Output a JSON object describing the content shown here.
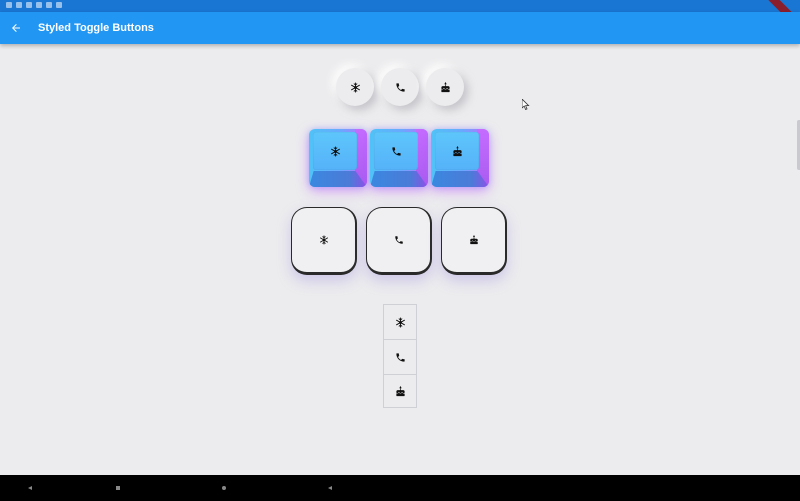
{
  "app_bar": {
    "title": "Styled Toggle Buttons",
    "back_icon": "arrow-back-icon",
    "color": "#2196f3"
  },
  "status_bar": {
    "color": "#1976d2"
  },
  "toggle_groups": [
    {
      "style": "neumorphic-circles",
      "buttons": [
        "ac-unit-icon",
        "call-icon",
        "cake-icon"
      ]
    },
    {
      "style": "gradient-keys",
      "buttons": [
        "ac-unit-icon",
        "call-icon",
        "cake-icon"
      ]
    },
    {
      "style": "outlined-rounded",
      "buttons": [
        "ac-unit-icon",
        "call-icon",
        "cake-icon"
      ]
    },
    {
      "style": "bordered-vertical",
      "buttons": [
        "ac-unit-icon",
        "call-icon",
        "cake-icon"
      ]
    }
  ],
  "nav_bar": {
    "buttons": [
      "back-icon",
      "home-icon",
      "recents-icon",
      "collapse-icon"
    ]
  },
  "colors": {
    "background": "#ececee",
    "gradient_start": "#4fc3f7",
    "gradient_end": "#c46bff"
  }
}
